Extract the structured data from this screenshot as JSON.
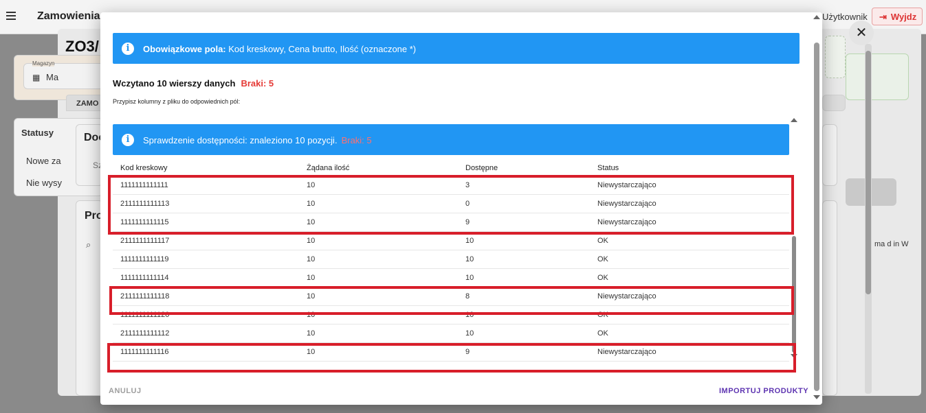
{
  "app": {
    "title": "Zamowienia",
    "user_label": "Użytkownik",
    "logout_label": "Wyjdz"
  },
  "background": {
    "heading": "ZO3/",
    "warehouse_label": "Magazyn",
    "warehouse_value": "Ma",
    "tab_label": "ZAMO",
    "statuses_title": "Statusy",
    "status_items": [
      "Nowe za",
      "Nie wysy"
    ],
    "doc_title": "Doc",
    "search_placeholder": "Sz",
    "products_title": "Pro",
    "side_text": "ma d in W"
  },
  "modal": {
    "required_info": {
      "bold": "Obowiązkowe pola:",
      "text": "Kod kreskowy, Cena brutto, Ilość (oznaczone *)"
    },
    "loaded": {
      "text": "Wczytano 10 wierszy danych",
      "missing": "Braki: 5"
    },
    "assign_hint": "Przypisz kolumny z pliku do odpowiednich pól:",
    "availability_info": {
      "text": "Sprawdzenie dostępności: znaleziono 10 pozycji.",
      "missing": "Braki: 5"
    },
    "table": {
      "headers": [
        "Kod kreskowy",
        "Żądana ilość",
        "Dostępne",
        "Status"
      ],
      "rows": [
        {
          "barcode": "1111111111111",
          "requested": "10",
          "available": "3",
          "status": "Niewystarczająco"
        },
        {
          "barcode": "2111111111113",
          "requested": "10",
          "available": "0",
          "status": "Niewystarczająco"
        },
        {
          "barcode": "1111111111115",
          "requested": "10",
          "available": "9",
          "status": "Niewystarczająco"
        },
        {
          "barcode": "2111111111117",
          "requested": "10",
          "available": "10",
          "status": "OK"
        },
        {
          "barcode": "1111111111119",
          "requested": "10",
          "available": "10",
          "status": "OK"
        },
        {
          "barcode": "1111111111114",
          "requested": "10",
          "available": "10",
          "status": "OK"
        },
        {
          "barcode": "2111111111118",
          "requested": "10",
          "available": "8",
          "status": "Niewystarczająco"
        },
        {
          "barcode": "1111111111120",
          "requested": "10",
          "available": "10",
          "status": "OK"
        },
        {
          "barcode": "2111111111112",
          "requested": "10",
          "available": "10",
          "status": "OK"
        },
        {
          "barcode": "1111111111116",
          "requested": "10",
          "available": "9",
          "status": "Niewystarczająco"
        }
      ]
    },
    "cancel_label": "ANULUJ",
    "import_label": "IMPORTUJ PRODUKTY"
  },
  "colors": {
    "info_blue": "#2196f3",
    "error_red": "#e53935",
    "ok_green": "#43a047",
    "highlight_red": "#d81e2a",
    "primary_purple": "#5e35b1"
  },
  "icons": [
    "menu-icon",
    "info-icon",
    "close-icon",
    "logout-icon",
    "warehouse-icon",
    "search-icon"
  ]
}
